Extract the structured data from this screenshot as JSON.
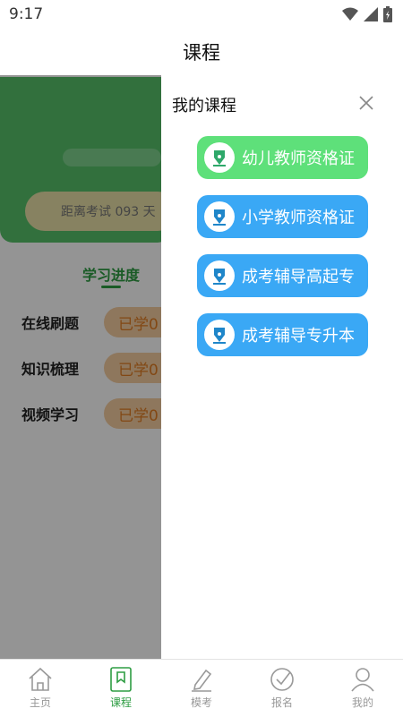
{
  "status_bar": {
    "time": "9:17"
  },
  "header": {
    "title": "课程"
  },
  "background": {
    "countdown_text": "距离考试 093 天",
    "progress_tab": "学习进度",
    "rows": [
      {
        "label": "在线刷题",
        "value": "已学0"
      },
      {
        "label": "知识梳理",
        "value": "已学0"
      },
      {
        "label": "视频学习",
        "value": "已学0"
      }
    ]
  },
  "drawer": {
    "title": "我的课程",
    "courses": [
      {
        "label": "幼儿教师资格证",
        "color": "#5ee07a",
        "icon": "pen-nib-icon"
      },
      {
        "label": "小学教师资格证",
        "color": "#3aa8f5",
        "icon": "pen-nib-icon"
      },
      {
        "label": "成考辅导高起专",
        "color": "#3aa8f5",
        "icon": "pen-nib-icon"
      },
      {
        "label": "成考辅导专升本",
        "color": "#3aa8f5",
        "icon": "pen-nib-icon"
      }
    ]
  },
  "bottom_nav": {
    "items": [
      {
        "label": "主页",
        "icon": "home-icon"
      },
      {
        "label": "课程",
        "icon": "bookmark-icon",
        "active": true
      },
      {
        "label": "模考",
        "icon": "pencil-icon"
      },
      {
        "label": "报名",
        "icon": "check-circle-icon"
      },
      {
        "label": "我的",
        "icon": "user-icon"
      }
    ]
  },
  "colors": {
    "accent": "#2e9d43",
    "course_active": "#5ee07a",
    "course_default": "#3aa8f5"
  }
}
